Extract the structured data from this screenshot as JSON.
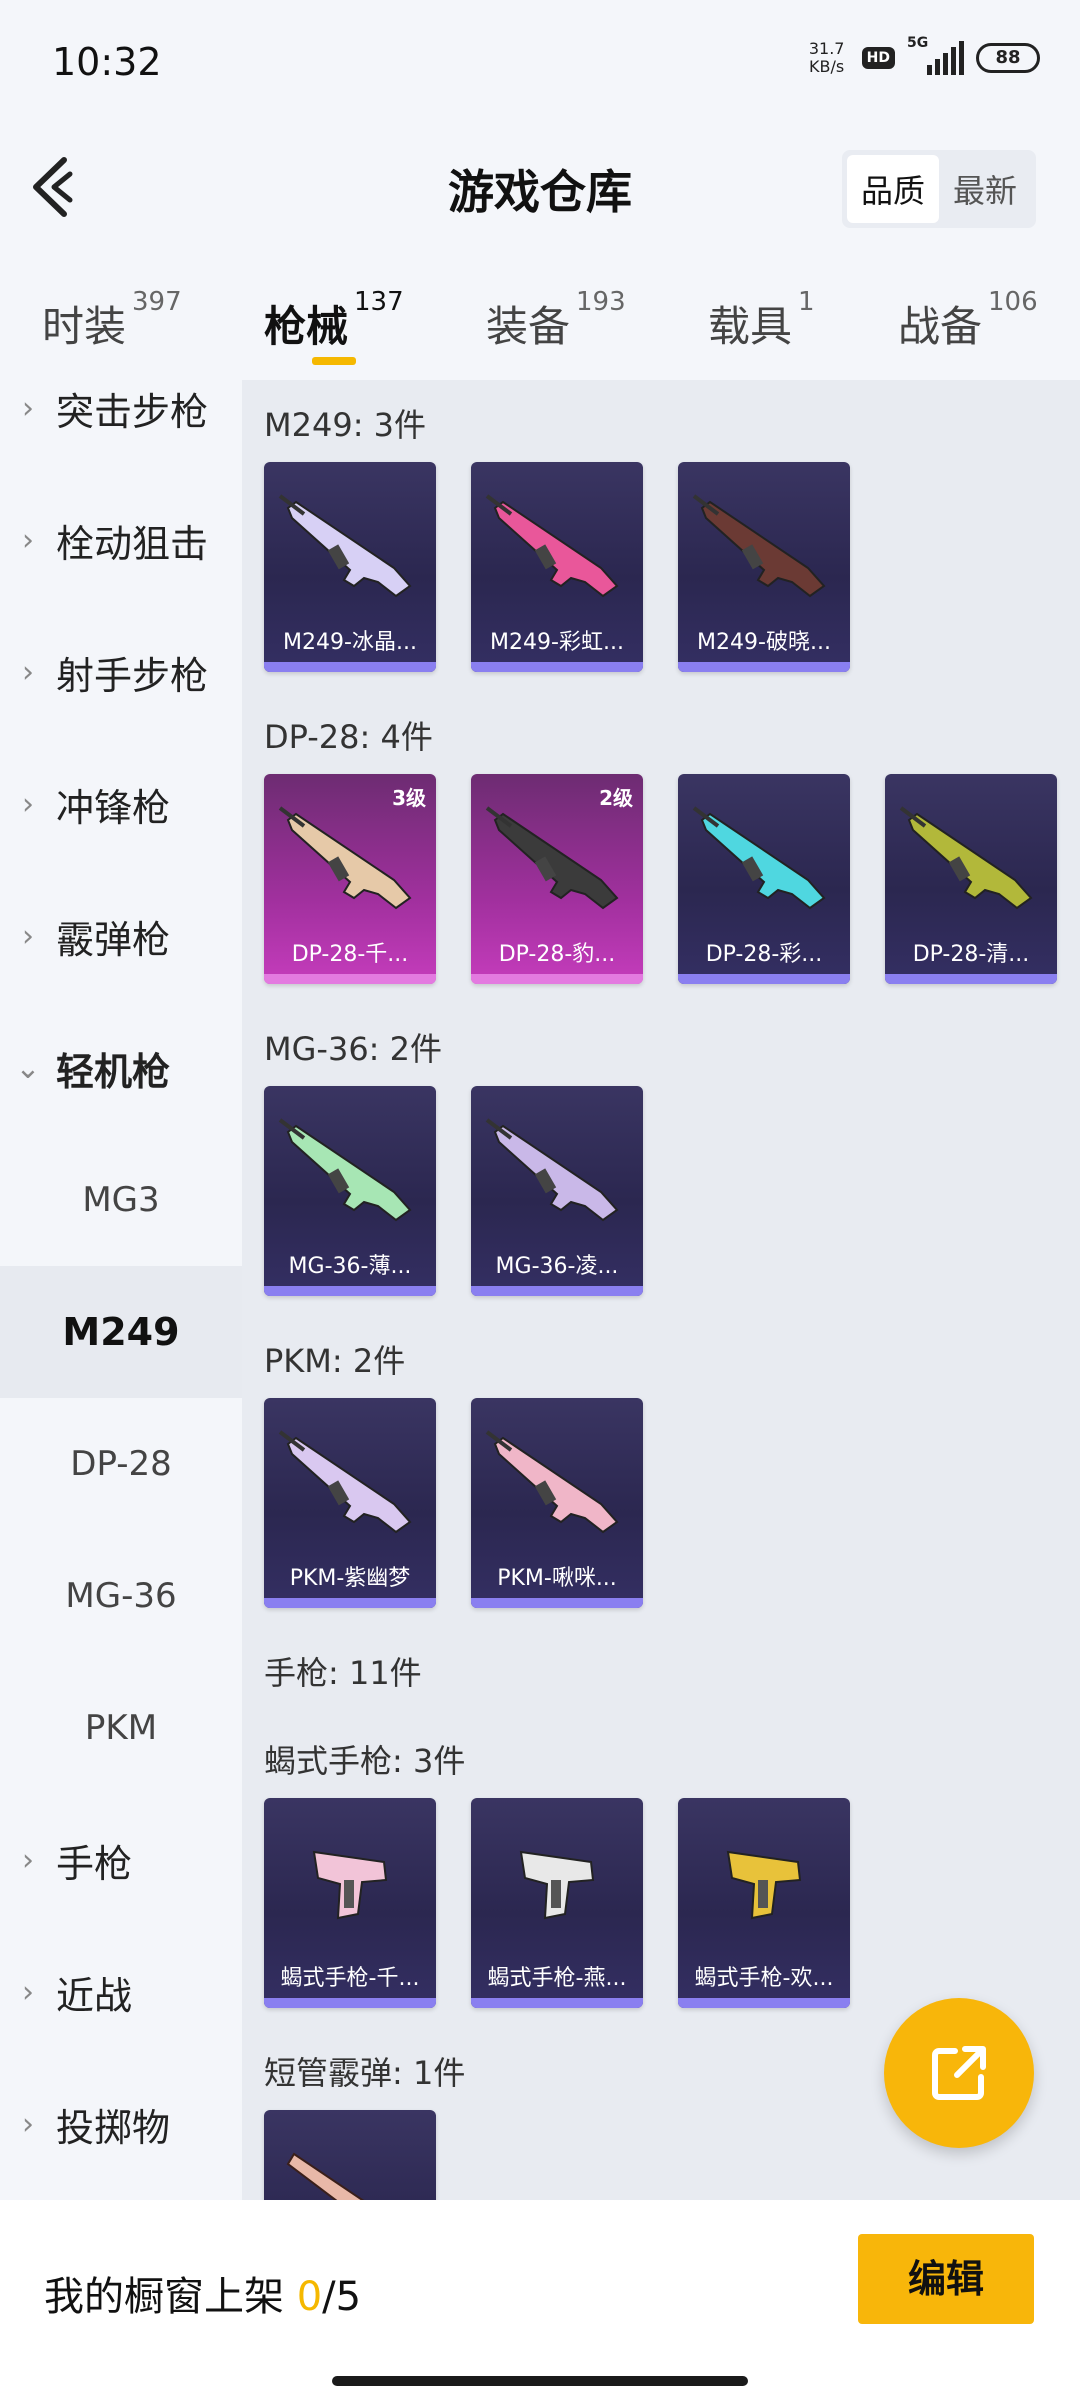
{
  "status": {
    "time": "10:32",
    "net_speed_value": "31.7",
    "net_speed_unit": "KB/s",
    "hd": "HD",
    "network": "5G",
    "battery": "88"
  },
  "header": {
    "title": "游戏仓库",
    "sort_options": [
      "品质",
      "最新"
    ],
    "sort_active": "品质"
  },
  "tabs": [
    {
      "label": "时装",
      "count": "397"
    },
    {
      "label": "枪械",
      "count": "137",
      "active": true
    },
    {
      "label": "装备",
      "count": "193"
    },
    {
      "label": "载具",
      "count": "1"
    },
    {
      "label": "战备",
      "count": "106"
    }
  ],
  "sidebar": {
    "categories": [
      "突击步枪",
      "栓动狙击",
      "射手步枪",
      "冲锋枪",
      "霰弹枪",
      "轻机枪",
      "手枪",
      "近战",
      "投掷物"
    ],
    "expanded": "轻机枪",
    "subitems": [
      "MG3",
      "M249",
      "DP-28",
      "MG-36",
      "PKM"
    ],
    "active_sub": "M249"
  },
  "groups": [
    {
      "title": "M249: 3件",
      "cards": [
        {
          "name": "M249-冰晶...",
          "level": "",
          "style": "purple",
          "icon": "rifle-icon",
          "accent": "#d7d0f5"
        },
        {
          "name": "M249-彩虹...",
          "level": "",
          "style": "purple",
          "icon": "rifle-icon",
          "accent": "#e9579a"
        },
        {
          "name": "M249-破晓...",
          "level": "",
          "style": "purple",
          "icon": "rifle-icon",
          "accent": "#6b3a34"
        }
      ]
    },
    {
      "title": "DP-28: 4件",
      "cards": [
        {
          "name": "DP-28-千...",
          "level": "3级",
          "style": "pink",
          "icon": "rifle-icon",
          "accent": "#e6c9a8"
        },
        {
          "name": "DP-28-豹...",
          "level": "2级",
          "style": "pink",
          "icon": "rifle-icon",
          "accent": "#3b3b3b"
        },
        {
          "name": "DP-28-彩...",
          "level": "",
          "style": "purple",
          "icon": "rifle-icon",
          "accent": "#4fd7e0"
        },
        {
          "name": "DP-28-清...",
          "level": "",
          "style": "purple",
          "icon": "rifle-icon",
          "accent": "#b2b83a"
        }
      ]
    },
    {
      "title": "MG-36: 2件",
      "cards": [
        {
          "name": "MG-36-薄...",
          "level": "",
          "style": "purple",
          "icon": "rifle-icon",
          "accent": "#a7e6b4"
        },
        {
          "name": "MG-36-凌...",
          "level": "",
          "style": "purple",
          "icon": "rifle-icon",
          "accent": "#c9b8e8"
        }
      ]
    },
    {
      "title": "PKM: 2件",
      "cards": [
        {
          "name": "PKM-紫幽梦",
          "level": "",
          "style": "purple",
          "icon": "rifle-icon",
          "accent": "#d9c8f0"
        },
        {
          "name": "PKM-啾咪...",
          "level": "",
          "style": "purple",
          "icon": "rifle-icon",
          "accent": "#f0b6c8"
        }
      ]
    },
    {
      "title": "手枪: 11件",
      "cards": []
    },
    {
      "title": "蝎式手枪: 3件",
      "cards": [
        {
          "name": "蝎式手枪-千...",
          "level": "",
          "style": "purple",
          "icon": "pistol-icon",
          "accent": "#f2c4d8"
        },
        {
          "name": "蝎式手枪-燕...",
          "level": "",
          "style": "purple",
          "icon": "pistol-icon",
          "accent": "#e8e8e8"
        },
        {
          "name": "蝎式手枪-欢...",
          "level": "",
          "style": "purple",
          "icon": "pistol-icon",
          "accent": "#e8c23a"
        }
      ]
    },
    {
      "title": "短管霰弹: 1件",
      "cards": [
        {
          "name": "",
          "level": "",
          "style": "purple",
          "icon": "shotgun-icon",
          "accent": "#e8b8a8"
        }
      ]
    }
  ],
  "bottom": {
    "prefix": "我的橱窗上架 ",
    "current": "0",
    "suffix": "/5",
    "edit_label": "编辑"
  },
  "colors": {
    "accent": "#f8b60a",
    "card_purple": "#2b2750",
    "card_pink": "#a1309e"
  }
}
